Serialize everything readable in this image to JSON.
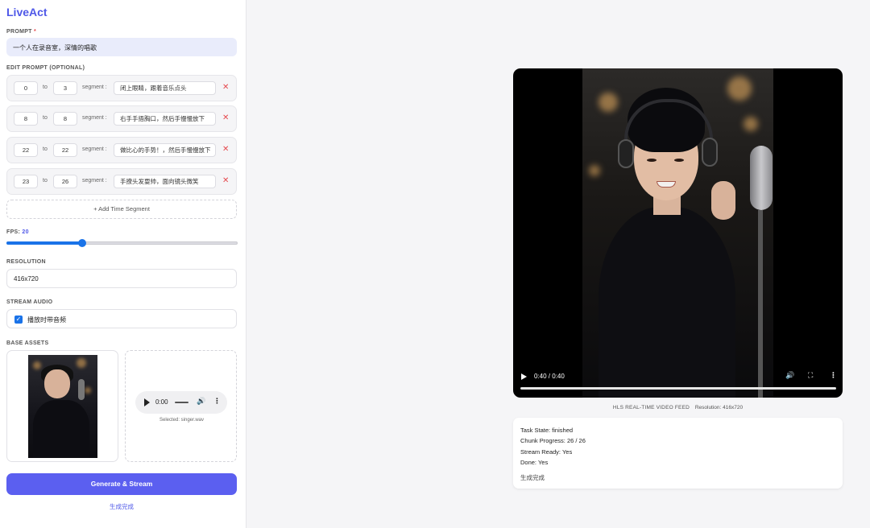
{
  "app": {
    "title": "LiveAct"
  },
  "prompt": {
    "label": "PROMPT",
    "required_mark": "*",
    "value": "一个人在录音室，深情的唱歌"
  },
  "edit_prompt": {
    "label": "EDIT PROMPT (OPTIONAL)",
    "to_label": "to",
    "segment_label": "segment :",
    "segments": [
      {
        "start": "0",
        "end": "3",
        "text": "闭上眼睛，跟着音乐点头"
      },
      {
        "start": "8",
        "end": "8",
        "text": "右手手捂胸口，然后手慢慢放下"
      },
      {
        "start": "22",
        "end": "22",
        "text": "做比心的手势！，然后手慢慢放下"
      },
      {
        "start": "23",
        "end": "26",
        "text": "手撩头发耍帅，面向镜头微笑"
      }
    ],
    "delete_glyph": "✕",
    "add_label": "+ Add Time Segment"
  },
  "fps": {
    "label": "FPS:",
    "value": "20",
    "fraction": 0.33
  },
  "resolution": {
    "label": "RESOLUTION",
    "value": "416x720"
  },
  "stream_audio": {
    "label": "STREAM AUDIO",
    "checkbox_label": "播放时带音频",
    "checked": true
  },
  "assets": {
    "label": "BASE ASSETS",
    "audio_time": "0:00",
    "selected_text": "Selected: singer.wav"
  },
  "actions": {
    "generate_label": "Generate & Stream",
    "status_text": "生成完成"
  },
  "video": {
    "time": "0:40 / 0:40",
    "progress": 1.0,
    "feed_label": "HLS REAL-TIME VIDEO FEED",
    "resolution_text": "Resolution: 416x720"
  },
  "status": {
    "task_state": "Task State: finished",
    "chunk_progress": "Chunk Progress: 26 / 26",
    "stream_ready": "Stream Ready: Yes",
    "done": "Done: Yes",
    "message": "生成完成"
  },
  "colors": {
    "accent": "#4f58e8",
    "button": "#5b5ff0",
    "slider": "#1a73e8",
    "delete": "#e5484d"
  },
  "icons": [
    "play-icon",
    "volume-icon",
    "fullscreen-icon",
    "more-vert-icon",
    "delete-icon",
    "checkbox-icon"
  ]
}
